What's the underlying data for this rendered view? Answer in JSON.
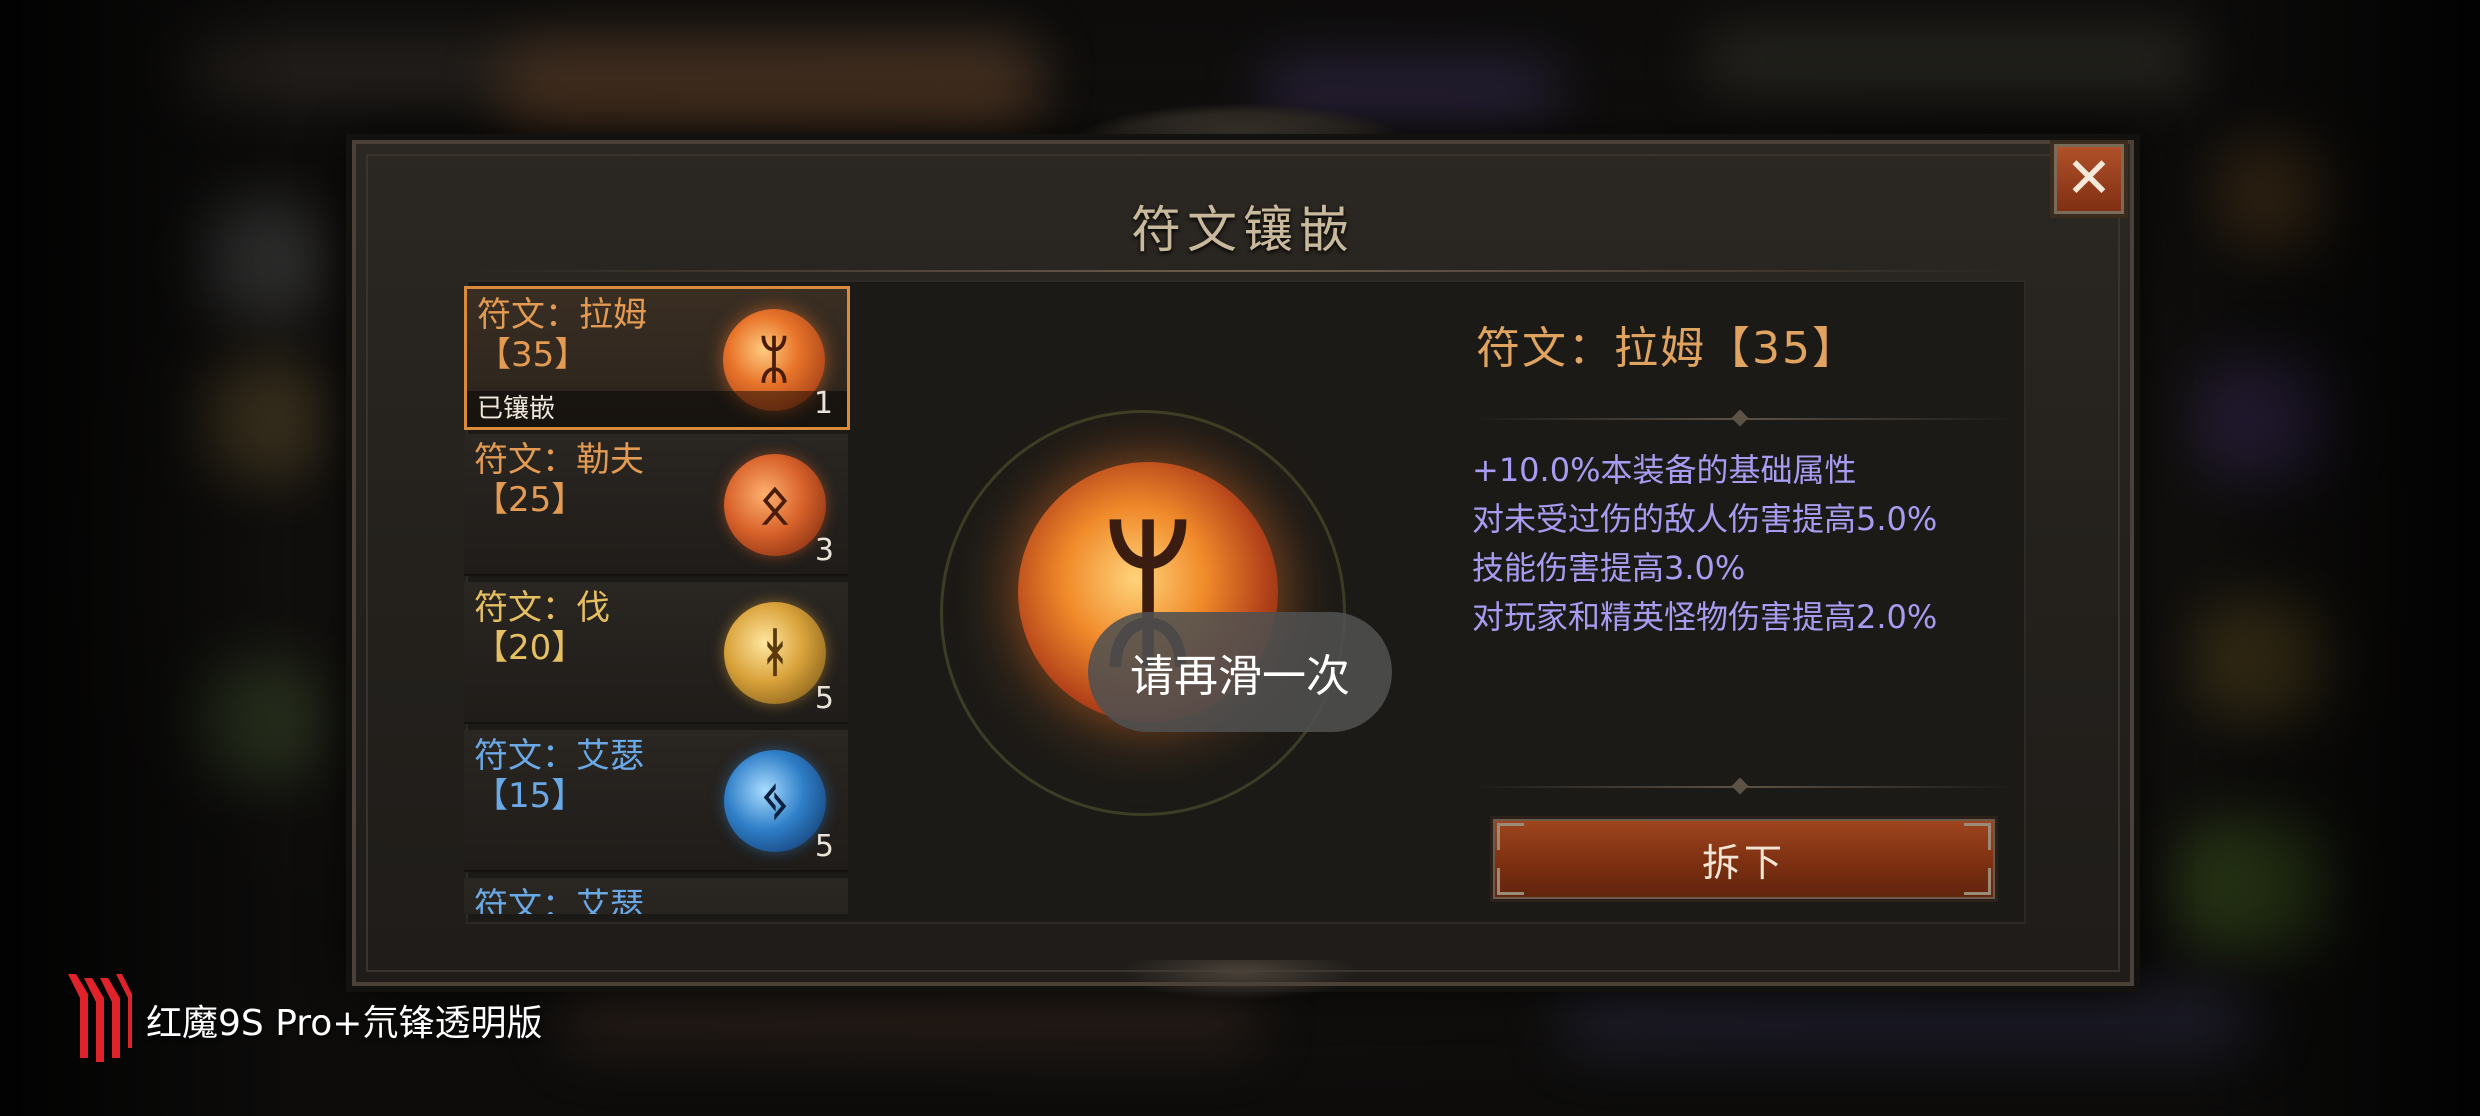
{
  "dialog": {
    "title": "符文镶嵌",
    "close_label": "✕"
  },
  "rune_list": {
    "items": [
      {
        "name": "符文：拉姆",
        "level": "【35】",
        "count": "1",
        "status": "已镶嵌",
        "color": "#e39a52",
        "orb_color": "#e8742a",
        "glyph": "ᛯ",
        "selected": true
      },
      {
        "name": "符文：勒夫",
        "level": "【25】",
        "count": "3",
        "color": "#e39a52",
        "orb_color": "#d8622a",
        "glyph": "ᛟ"
      },
      {
        "name": "符文：伐",
        "level": "【20】",
        "count": "5",
        "color": "#e6bf62",
        "orb_color": "#d9a23a",
        "glyph": "ᚼ"
      },
      {
        "name": "符文：艾瑟",
        "level": "【15】",
        "count": "5",
        "color": "#6aa8e6",
        "orb_color": "#2f7fc8",
        "glyph": "ᛃ"
      }
    ],
    "partial_item_name": "符文：艾瑟"
  },
  "center": {
    "rune_glyph": "ᛯ",
    "toast": "请再滑一次"
  },
  "detail": {
    "title": "符文：拉姆【35】",
    "attributes": [
      "+10.0%本装备的基础属性",
      "对未受过伤的敌人伤害提高5.0%",
      "技能伤害提高3.0%",
      "对玩家和精英怪物伤害提高2.0%"
    ],
    "remove_button": "拆下"
  },
  "watermark": {
    "text": "红魔9S Pro+氘锋透明版",
    "logo_color": "#e0222a"
  }
}
